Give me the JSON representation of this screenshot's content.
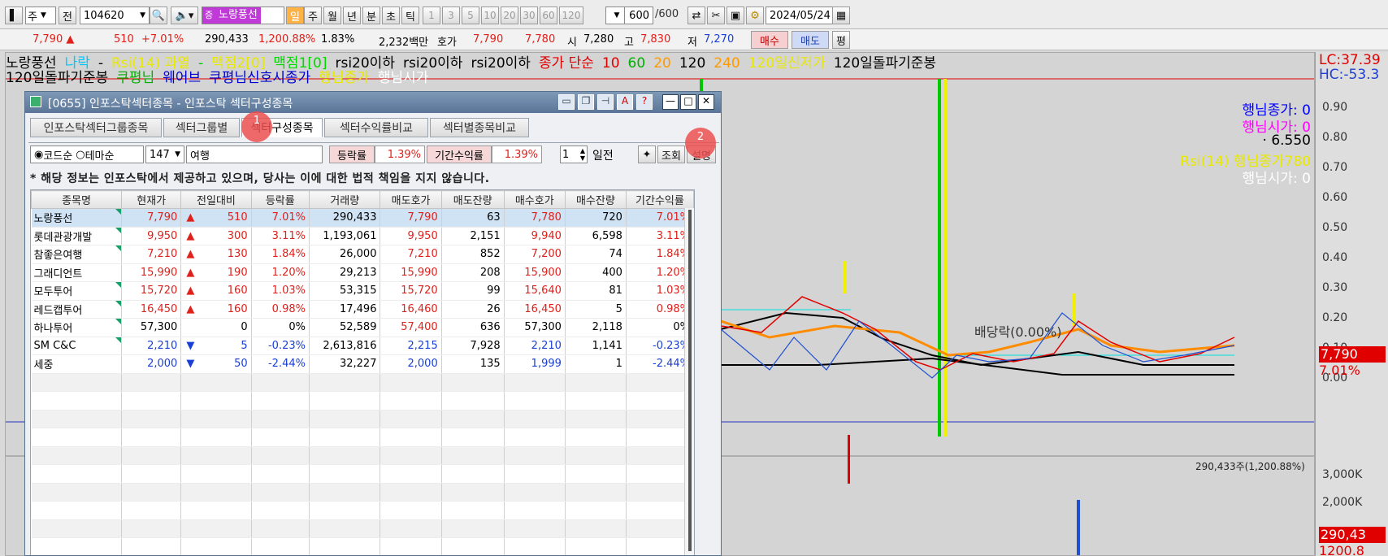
{
  "toolbar": {
    "market": "주",
    "period_btn": "전",
    "code": "104620",
    "stock_name": "노랑풍선",
    "timeframes": [
      "일",
      "주",
      "월",
      "년",
      "분",
      "초",
      "틱"
    ],
    "minutes": [
      "1",
      "3",
      "5",
      "10",
      "20",
      "30",
      "60",
      "120"
    ],
    "count": "600",
    "count_max": "/600",
    "date": "2024/05/24"
  },
  "quote": {
    "price": "7,790 ▲",
    "change": "510",
    "change_pct": "+7.01%",
    "volume": "290,433",
    "vol_ratio": "1,200.88%",
    "turnover_pct": "1.83%",
    "amount": "2,232백만",
    "ask_label": "호가",
    "ask": "7,790",
    "bid": "7,780",
    "open_label": "시",
    "open": "7,280",
    "high_label": "고",
    "high": "7,830",
    "low_label": "저",
    "low": "7,270",
    "buy_label": "매수",
    "sell_label": "매도",
    "flat_label": "평"
  },
  "legend1": [
    {
      "t": "노랑풍선",
      "c": "#000000"
    },
    {
      "t": "나락",
      "c": "#00c8ff"
    },
    {
      "t": "-",
      "c": "#000000"
    },
    {
      "t": "Rsi(14) 과열",
      "c": "#e8e800"
    },
    {
      "t": "-",
      "c": "#00c800"
    },
    {
      "t": "맥점2[0]",
      "c": "#e8e800"
    },
    {
      "t": "맥점1[0]",
      "c": "#00d800"
    },
    {
      "t": "rsi20이하",
      "c": "#000000"
    },
    {
      "t": "rsi20이하",
      "c": "#000000"
    },
    {
      "t": "rsi20이하",
      "c": "#000000"
    },
    {
      "t": "종가 단순",
      "c": "#e00000"
    },
    {
      "t": "10",
      "c": "#e00000"
    },
    {
      "t": "60",
      "c": "#00b000"
    },
    {
      "t": "20",
      "c": "#ff9900"
    },
    {
      "t": "120",
      "c": "#000000"
    },
    {
      "t": "240",
      "c": "#ff9900"
    },
    {
      "t": "120일신저가",
      "c": "#e8e800"
    },
    {
      "t": "120일돌파기준봉",
      "c": "#000000"
    }
  ],
  "legend2": [
    {
      "t": "120일돌파기준봉",
      "c": "#000000"
    },
    {
      "t": "쿠평님",
      "c": "#00b000"
    },
    {
      "t": "웨어브",
      "c": "#0000d0"
    },
    {
      "t": "쿠평님신호시종가",
      "c": "#0000d0"
    },
    {
      "t": "행님종가",
      "c": "#e8e800"
    },
    {
      "t": "행님시가",
      "c": "#ffffff"
    }
  ],
  "chart": {
    "dividend_label": "배당락(0.00%)",
    "volume_label": "290,433주(1,200.88%)",
    "price_tag": "7,790",
    "pct_tag": "7.01%",
    "vol_tag": "290,43",
    "vol_tag2": "1200.8",
    "lc": "LC:37.39",
    "hc": "HC:-53.3",
    "y_ticks": [
      "0.90",
      "0.80",
      "0.70",
      "0.60",
      "0.50",
      "0.40",
      "0.30",
      "0.20",
      "0.10",
      "0.00"
    ],
    "vol_ticks": [
      "3,000K",
      "2,000K"
    ],
    "ind_labels": [
      {
        "t": "행님종가: 0",
        "c": "#0000ff"
      },
      {
        "t": "행님시가: 0",
        "c": "#ff00ff"
      },
      {
        "t": "· 6.550",
        "c": "#000000"
      },
      {
        "t": "Rsi(14) 행님종가780",
        "c": "#e8e800"
      },
      {
        "t": "행님시가: 0",
        "c": "#ffffff"
      }
    ]
  },
  "window": {
    "title": "[0655] 인포스탁섹터종목 - 인포스탁 섹터구성종목",
    "tabs": [
      "인포스탁섹터그룹종목",
      "섹터그룹별",
      "섹터구성종목",
      "섹터수익률비교",
      "섹터별종목비교"
    ],
    "active_tab": 2,
    "radio_code": "코드순",
    "radio_theme": "테마순",
    "sector_no": "147",
    "sector_name": "여행",
    "rate_label": "등락률",
    "rate_value": "1.39%",
    "period_label": "기간수익률",
    "period_value": "1.39%",
    "days": "1",
    "days_label": "일전",
    "search_btn": "조회",
    "help_btn": "설명",
    "notice": "* 해당 정보는 인포스탁에서 제공하고 있으며, 당사는 이에 대한 법적 책임을 지지 않습니다.",
    "badge1": "1",
    "badge2": "2",
    "columns": [
      "종목명",
      "현재가",
      "전일대비",
      "등락률",
      "거래량",
      "매도호가",
      "매도잔량",
      "매수호가",
      "매수잔량",
      "기간수익률"
    ],
    "rows": [
      {
        "name": "노랑풍선",
        "price": "7,790",
        "sign": "▲",
        "chg": "510",
        "pct": "7.01%",
        "vol": "290,433",
        "ask": "7,790",
        "askq": "63",
        "bid": "7,780",
        "bidq": "720",
        "per": "7.01%",
        "dir": "up",
        "tri": true
      },
      {
        "name": "롯데관광개발",
        "price": "9,950",
        "sign": "▲",
        "chg": "300",
        "pct": "3.11%",
        "vol": "1,193,061",
        "ask": "9,950",
        "askq": "2,151",
        "bid": "9,940",
        "bidq": "6,598",
        "per": "3.11%",
        "dir": "up",
        "tri": true
      },
      {
        "name": "참좋은여행",
        "price": "7,210",
        "sign": "▲",
        "chg": "130",
        "pct": "1.84%",
        "vol": "26,000",
        "ask": "7,210",
        "askq": "852",
        "bid": "7,200",
        "bidq": "74",
        "per": "1.84%",
        "dir": "up",
        "tri": true
      },
      {
        "name": "그래디언트",
        "price": "15,990",
        "sign": "▲",
        "chg": "190",
        "pct": "1.20%",
        "vol": "29,213",
        "ask": "15,990",
        "askq": "208",
        "bid": "15,900",
        "bidq": "400",
        "per": "1.20%",
        "dir": "up",
        "tri": false
      },
      {
        "name": "모두투어",
        "price": "15,720",
        "sign": "▲",
        "chg": "160",
        "pct": "1.03%",
        "vol": "53,315",
        "ask": "15,720",
        "askq": "99",
        "bid": "15,640",
        "bidq": "81",
        "per": "1.03%",
        "dir": "up",
        "tri": true
      },
      {
        "name": "레드캡투어",
        "price": "16,450",
        "sign": "▲",
        "chg": "160",
        "pct": "0.98%",
        "vol": "17,496",
        "ask": "16,460",
        "askq": "26",
        "bid": "16,450",
        "bidq": "5",
        "per": "0.98%",
        "dir": "up",
        "tri": true
      },
      {
        "name": "하나투어",
        "price": "57,300",
        "sign": "",
        "chg": "0",
        "pct": "0%",
        "vol": "52,589",
        "ask": "57,400",
        "askq": "636",
        "bid": "57,300",
        "bidq": "2,118",
        "per": "0%",
        "dir": "flat",
        "tri": true
      },
      {
        "name": "SM C&C",
        "price": "2,210",
        "sign": "▼",
        "chg": "5",
        "pct": "-0.23%",
        "vol": "2,613,816",
        "ask": "2,215",
        "askq": "7,928",
        "bid": "2,210",
        "bidq": "1,141",
        "per": "-0.23%",
        "dir": "dn",
        "tri": true
      },
      {
        "name": "세중",
        "price": "2,000",
        "sign": "▼",
        "chg": "50",
        "pct": "-2.44%",
        "vol": "32,227",
        "ask": "2,000",
        "askq": "135",
        "bid": "1,999",
        "bidq": "1",
        "per": "-2.44%",
        "dir": "dn",
        "tri": false
      }
    ]
  }
}
